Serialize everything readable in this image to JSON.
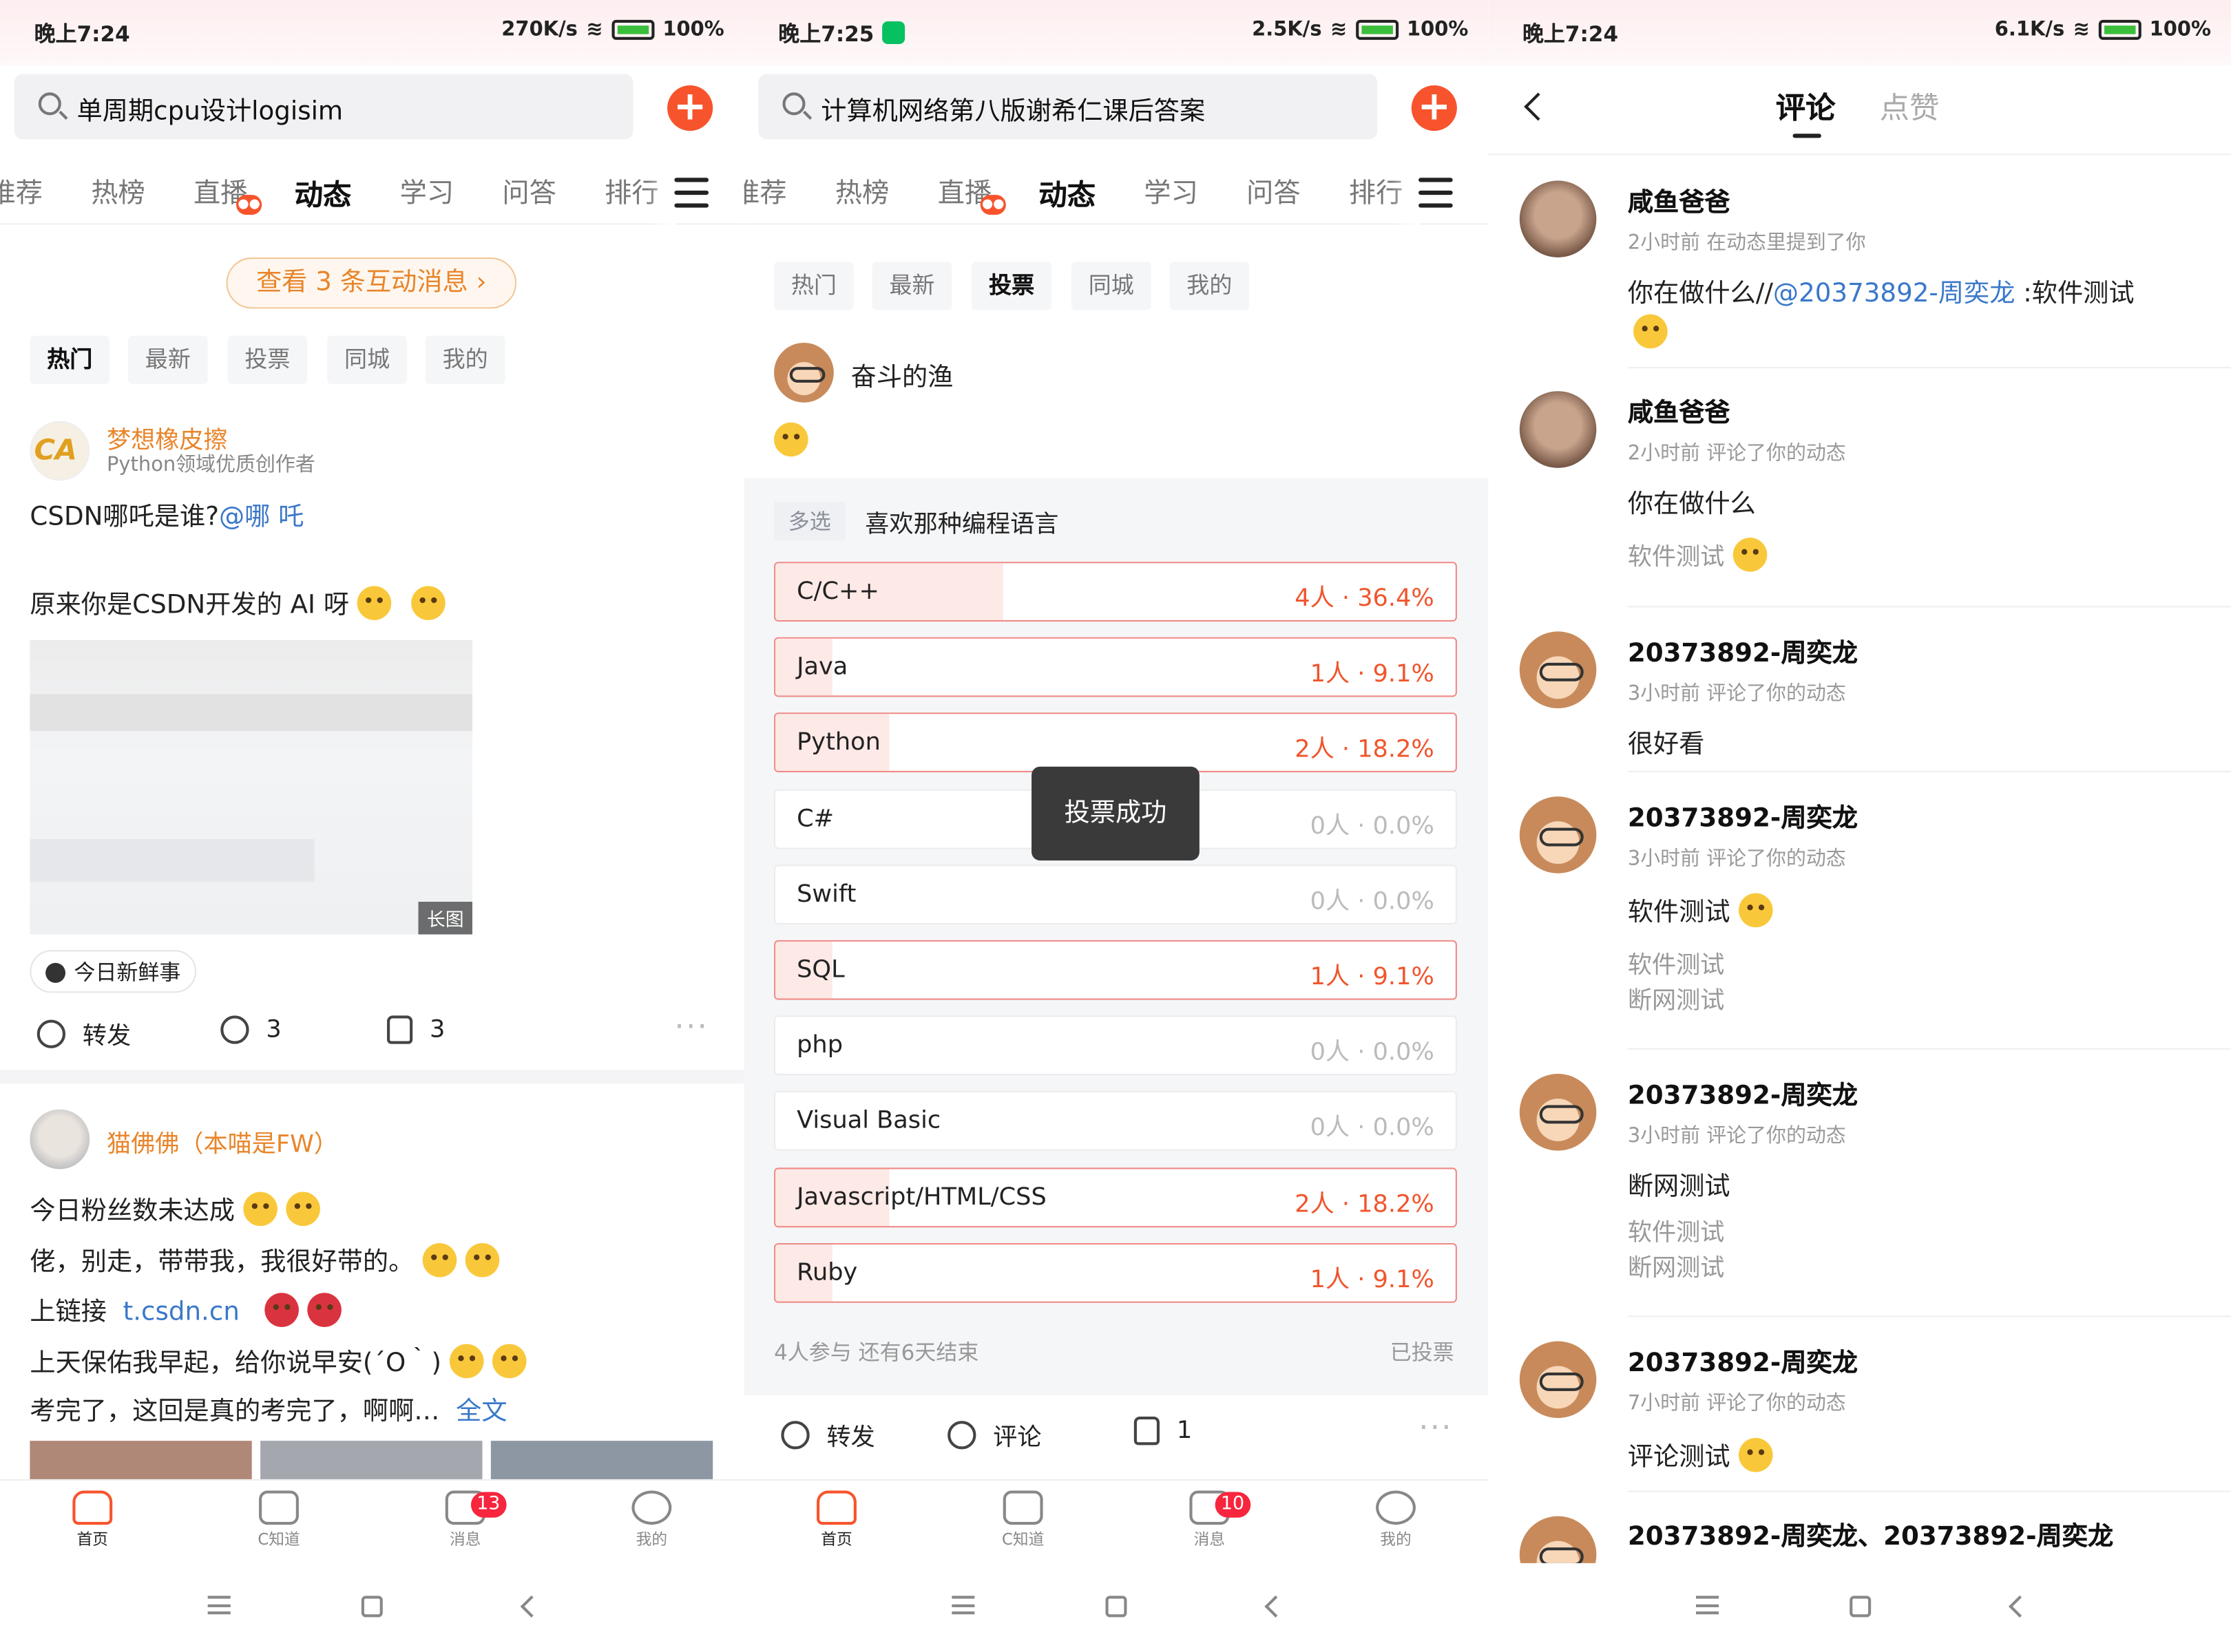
{
  "panel1": {
    "status": {
      "time": "晚上7:24",
      "speed": "270K/s",
      "battery": "100%"
    },
    "search": {
      "query": "单周期cpu设计logisim"
    },
    "tabs": [
      "推荐",
      "热榜",
      "直播",
      "动态",
      "学习",
      "问答",
      "排行"
    ],
    "active_tab": "动态",
    "interaction_btn": "查看 3 条互动消息 ›",
    "filters": [
      "热门",
      "最新",
      "投票",
      "同城",
      "我的"
    ],
    "active_filter": "热门",
    "post1": {
      "author": "梦想橡皮擦",
      "author_sub": "Python领域优质创作者",
      "line1": "CSDN哪吒是谁?",
      "mention": "@哪 吒",
      "line2": "原来你是CSDN开发的 AI 呀",
      "image_tag": "长图",
      "topic": "今日新鲜事",
      "forward": "转发",
      "comments": "3",
      "likes": "3"
    },
    "post2": {
      "author": "猫佛佛（本喵是FW）",
      "l1": "今日粉丝数未达成",
      "l2": "佬，别走，带带我，我很好带的。",
      "l3a": "上链接",
      "l3b": "t.csdn.cn",
      "l4": "上天保佑我早起，给你说早安(´O｀)",
      "l5": "考完了，这回是真的考完了，啊啊…",
      "more": "全文"
    },
    "tabbar": {
      "home": "首页",
      "c": "C知道",
      "msg": "消息",
      "msg_badge": "13",
      "me": "我的"
    }
  },
  "panel2": {
    "status": {
      "time": "晚上7:25",
      "speed": "2.5K/s",
      "battery": "100%"
    },
    "search": {
      "query": "计算机网络第八版谢希仁课后答案"
    },
    "filters": [
      "热门",
      "最新",
      "投票",
      "同城",
      "我的"
    ],
    "active_filter": "投票",
    "author": "奋斗的渔",
    "poll": {
      "type": "多选",
      "question": "喜欢那种编程语言",
      "options": [
        {
          "label": "C/C++",
          "result": "4人 · 36.4%",
          "pct": 0.364,
          "voted": true
        },
        {
          "label": "Java",
          "result": "1人 · 9.1%",
          "pct": 0.091,
          "voted": true
        },
        {
          "label": "Python",
          "result": "2人 · 18.2%",
          "pct": 0.182,
          "voted": true
        },
        {
          "label": "C#",
          "result": "0人 · 0.0%",
          "pct": 0,
          "voted": false
        },
        {
          "label": "Swift",
          "result": "0人 · 0.0%",
          "pct": 0,
          "voted": false
        },
        {
          "label": "SQL",
          "result": "1人 · 9.1%",
          "pct": 0.091,
          "voted": true
        },
        {
          "label": "php",
          "result": "0人 · 0.0%",
          "pct": 0,
          "voted": false
        },
        {
          "label": "Visual Basic",
          "result": "0人 · 0.0%",
          "pct": 0,
          "voted": false
        },
        {
          "label": "Javascript/HTML/CSS",
          "result": "2人 · 18.2%",
          "pct": 0.182,
          "voted": true
        },
        {
          "label": "Ruby",
          "result": "1人 · 9.1%",
          "pct": 0.091,
          "voted": true
        }
      ],
      "footer_left": "4人参与  还有6天结束",
      "footer_right": "已投票"
    },
    "toast": "投票成功",
    "actions": {
      "forward": "转发",
      "comment": "评论",
      "likes": "1"
    },
    "tabbar": {
      "home": "首页",
      "c": "C知道",
      "msg": "消息",
      "msg_badge": "10",
      "me": "我的"
    }
  },
  "panel3": {
    "status": {
      "time": "晚上7:24",
      "speed": "6.1K/s",
      "battery": "100%"
    },
    "tabs": {
      "comments": "评论",
      "likes": "点赞"
    },
    "items": [
      {
        "user": "咸鱼爸爸",
        "meta": "2小时前   在动态里提到了你",
        "body_a": "你在做什么//",
        "body_link": "@20373892-周奕龙",
        "body_b": " :软件测试"
      },
      {
        "user": "咸鱼爸爸",
        "meta": "2小时前   评论了你的动态",
        "body": "你在做什么",
        "quote": "软件测试"
      },
      {
        "user": "20373892-周奕龙",
        "meta": "3小时前   评论了你的动态",
        "body": "很好看"
      },
      {
        "user": "20373892-周奕龙",
        "meta": "3小时前   评论了你的动态",
        "body": "软件测试",
        "quote1": "软件测试",
        "quote2": "断网测试"
      },
      {
        "user": "20373892-周奕龙",
        "meta": "3小时前   评论了你的动态",
        "body": "断网测试",
        "quote1": "软件测试",
        "quote2": "断网测试"
      },
      {
        "user": "20373892-周奕龙",
        "meta": "7小时前   评论了你的动态",
        "body": "评论测试"
      },
      {
        "user": "20373892-周奕龙、20373892-周奕龙"
      }
    ]
  }
}
